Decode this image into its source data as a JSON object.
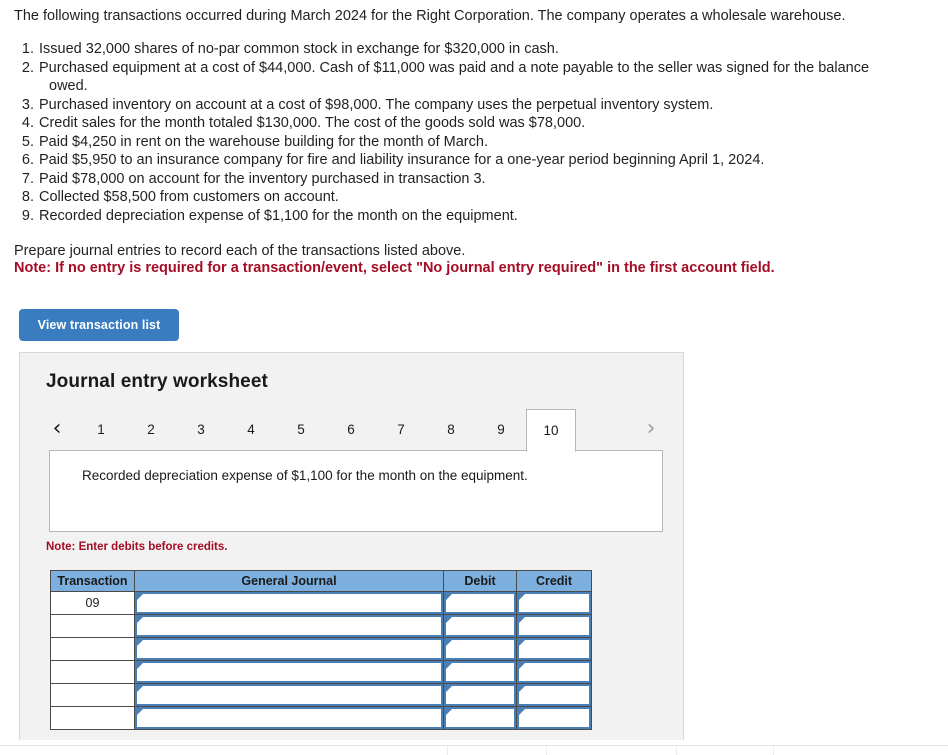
{
  "intro": "The following transactions occurred during March 2024 for the Right Corporation. The company operates a wholesale warehouse.",
  "transactions": [
    {
      "num": "1.",
      "text": "Issued 32,000 shares of no-par common stock in exchange for $320,000 in cash.",
      "cont": ""
    },
    {
      "num": "2.",
      "text": "Purchased equipment at a cost of $44,000. Cash of $11,000 was paid and a note payable to the seller was signed for the balance",
      "cont": "owed."
    },
    {
      "num": "3.",
      "text": "Purchased inventory on account at a cost of $98,000. The company uses the perpetual inventory system.",
      "cont": ""
    },
    {
      "num": "4.",
      "text": "Credit sales for the month totaled $130,000. The cost of the goods sold was $78,000.",
      "cont": ""
    },
    {
      "num": "5.",
      "text": "Paid $4,250 in rent on the warehouse building for the month of March.",
      "cont": ""
    },
    {
      "num": "6.",
      "text": "Paid $5,950 to an insurance company for fire and liability insurance for a one-year period beginning April 1, 2024.",
      "cont": ""
    },
    {
      "num": "7.",
      "text": "Paid $78,000 on account for the inventory purchased in transaction 3.",
      "cont": ""
    },
    {
      "num": "8.",
      "text": "Collected $58,500 from customers on account.",
      "cont": ""
    },
    {
      "num": "9.",
      "text": "Recorded depreciation expense of $1,100 for the month on the equipment.",
      "cont": ""
    }
  ],
  "prepare": "Prepare journal entries to record each of the transactions listed above.",
  "note_red": "Note: If no entry is required for a transaction/event, select \"No journal entry required\" in the first account field.",
  "button": {
    "view_transaction_list": "View transaction list"
  },
  "worksheet": {
    "title": "Journal entry worksheet",
    "prev_arrow": "‹",
    "next_arrow": "›",
    "tabs": [
      "1",
      "2",
      "3",
      "4",
      "5",
      "6",
      "7",
      "8",
      "9",
      "10"
    ],
    "selected_tab": "10",
    "content_text": "Recorded depreciation expense of $1,100 for the month on the equipment.",
    "note_debits": "Note: Enter debits before credits."
  },
  "journal_table": {
    "headers": [
      "Transaction",
      "General Journal",
      "Debit",
      "Credit"
    ],
    "rows": [
      {
        "transaction": "09",
        "general_journal": "",
        "debit": "",
        "credit": ""
      },
      {
        "transaction": "",
        "general_journal": "",
        "debit": "",
        "credit": ""
      },
      {
        "transaction": "",
        "general_journal": "",
        "debit": "",
        "credit": ""
      },
      {
        "transaction": "",
        "general_journal": "",
        "debit": "",
        "credit": ""
      },
      {
        "transaction": "",
        "general_journal": "",
        "debit": "",
        "credit": ""
      },
      {
        "transaction": "",
        "general_journal": "",
        "debit": "",
        "credit": ""
      }
    ]
  },
  "colors": {
    "accent_blue": "#3a7cc0",
    "header_blue": "#7cafdd",
    "cell_border_blue": "#4a7fb5",
    "note_red": "#a50d24",
    "panel_bg": "#f2f2f2"
  }
}
